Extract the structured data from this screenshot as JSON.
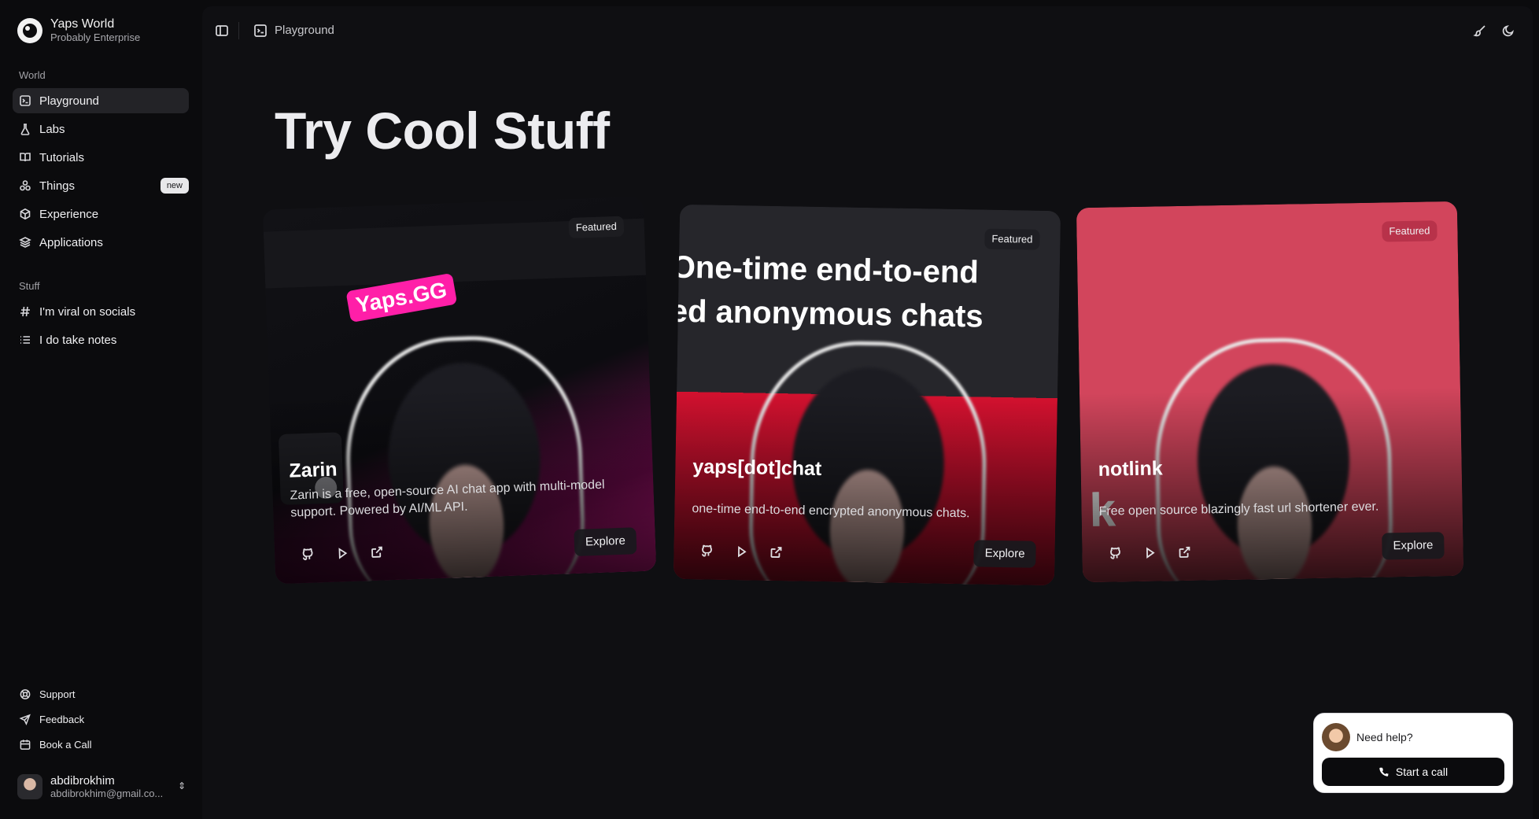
{
  "brand": {
    "name": "Yaps World",
    "subtitle": "Probably Enterprise"
  },
  "sidebar": {
    "section_world": "World",
    "world_items": [
      {
        "label": "Playground",
        "icon": "terminal-square-icon",
        "active": true
      },
      {
        "label": "Labs",
        "icon": "flask-icon"
      },
      {
        "label": "Tutorials",
        "icon": "book-open-icon"
      },
      {
        "label": "Things",
        "icon": "boxes-icon",
        "badge": "new"
      },
      {
        "label": "Experience",
        "icon": "package-icon"
      },
      {
        "label": "Applications",
        "icon": "layers-icon"
      }
    ],
    "section_stuff": "Stuff",
    "stuff_items": [
      {
        "label": "I'm viral on socials",
        "icon": "hash-icon"
      },
      {
        "label": "I do take notes",
        "icon": "list-icon"
      }
    ],
    "bottom_items": [
      {
        "label": "Support",
        "icon": "life-buoy-icon"
      },
      {
        "label": "Feedback",
        "icon": "send-icon"
      },
      {
        "label": "Book a Call",
        "icon": "calendar-icon"
      }
    ],
    "user": {
      "name": "abdibrokhim",
      "email": "abdibrokhim@gmail.co..."
    }
  },
  "topbar": {
    "breadcrumb": "Playground"
  },
  "main": {
    "title": "Try Cool Stuff"
  },
  "cards": [
    {
      "title": "Zarin",
      "description": "Zarin is a free, open-source AI chat app with multi-model support. Powered by AI/ML API.",
      "badge": "Featured",
      "explore": "Explore",
      "overlay": "Yaps.GG",
      "accent": "#ff1fa8"
    },
    {
      "title": "yaps[dot]chat",
      "description": "one-time end-to-end encrypted anonymous chats.",
      "badge": "Featured",
      "explore": "Explore",
      "overlay_line1": "One-time end-to-end",
      "overlay_line2": "ed anonymous chats",
      "accent": "#d4112f"
    },
    {
      "title": "notlink",
      "description": "Free open source blazingly fast url shortener ever.",
      "badge": "Featured",
      "explore": "Explore",
      "overlay": "k",
      "accent": "#d2455c"
    }
  ],
  "help": {
    "prompt": "Need help?",
    "button": "Start a call"
  }
}
